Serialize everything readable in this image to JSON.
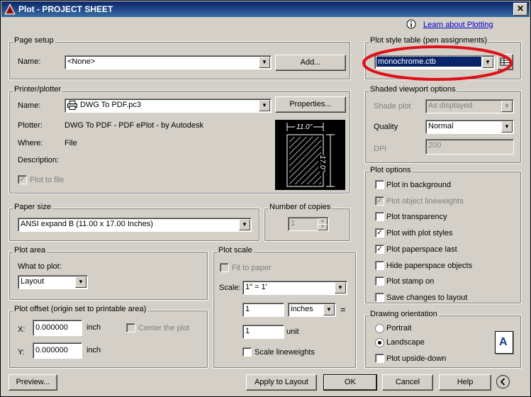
{
  "window": {
    "title": "Plot - PROJECT SHEET",
    "close_label": "✕"
  },
  "help": {
    "learn_link": "Learn about Plotting"
  },
  "page_setup": {
    "legend": "Page setup",
    "name_label": "Name:",
    "name_value": "<None>",
    "add_label": "Add..."
  },
  "printer": {
    "legend": "Printer/plotter",
    "name_label": "Name:",
    "name_value": "DWG To PDF.pc3",
    "properties_label": "Properties...",
    "plotter_label": "Plotter:",
    "plotter_value": "DWG To PDF - PDF ePlot - by Autodesk",
    "where_label": "Where:",
    "where_value": "File",
    "description_label": "Description:",
    "plot_to_file_label": "Plot to file",
    "preview_width": "11.0\"",
    "preview_height": "17.0\""
  },
  "paper_size": {
    "legend": "Paper size",
    "value": "ANSI expand B (11.00 x 17.00 Inches)"
  },
  "copies": {
    "legend": "Number of copies",
    "value": "1"
  },
  "plot_area": {
    "legend": "Plot area",
    "what_label": "What to plot:",
    "what_value": "Layout"
  },
  "plot_offset": {
    "legend": "Plot offset (origin set to printable area)",
    "x_label": "X:",
    "x_value": "0.000000",
    "x_unit": "inch",
    "y_label": "Y:",
    "y_value": "0.000000",
    "y_unit": "inch",
    "center_label": "Center the plot"
  },
  "plot_scale": {
    "legend": "Plot scale",
    "fit_label": "Fit to paper",
    "scale_label": "Scale:",
    "scale_value": "1\" = 1'",
    "value1": "1",
    "unit1": "inches",
    "equals": "=",
    "value2": "1",
    "unit2": "unit",
    "lineweights_label": "Scale lineweights"
  },
  "style_table": {
    "legend": "Plot style table (pen assignments)",
    "value": "monochrome.ctb"
  },
  "shaded": {
    "legend": "Shaded viewport options",
    "shade_label": "Shade plot",
    "shade_value": "As displayed",
    "quality_label": "Quality",
    "quality_value": "Normal",
    "dpi_label": "DPI",
    "dpi_value": "200"
  },
  "plot_options": {
    "legend": "Plot options",
    "items": [
      {
        "label": "Plot in background",
        "checked": false,
        "disabled": false
      },
      {
        "label": "Plot object lineweights",
        "checked": true,
        "disabled": true
      },
      {
        "label": "Plot transparency",
        "checked": false,
        "disabled": false
      },
      {
        "label": "Plot with plot styles",
        "checked": true,
        "disabled": false
      },
      {
        "label": "Plot paperspace last",
        "checked": true,
        "disabled": false
      },
      {
        "label": "Hide paperspace objects",
        "checked": false,
        "disabled": false
      },
      {
        "label": "Plot stamp on",
        "checked": false,
        "disabled": false
      },
      {
        "label": "Save changes to layout",
        "checked": false,
        "disabled": false
      }
    ]
  },
  "orientation": {
    "legend": "Drawing orientation",
    "portrait_label": "Portrait",
    "landscape_label": "Landscape",
    "upside_label": "Plot upside-down",
    "icon_letter": "A"
  },
  "footer": {
    "preview_label": "Preview...",
    "apply_label": "Apply to Layout",
    "ok_label": "OK",
    "cancel_label": "Cancel",
    "help_label": "Help"
  },
  "colors": {
    "highlight_oval": "#e0101a",
    "title_bar": "#0a246a",
    "selection": "#0a246a"
  }
}
